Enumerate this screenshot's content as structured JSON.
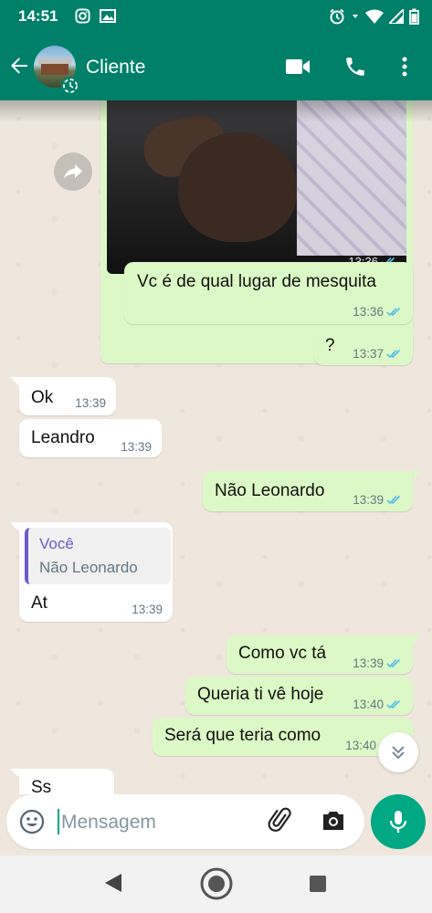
{
  "status_bar": {
    "time": "14:51"
  },
  "header": {
    "contact_name": "Cliente"
  },
  "messages": [
    {
      "dir": "out",
      "type": "image",
      "time": "13:36"
    },
    {
      "dir": "out",
      "text": "Vc é de qual lugar de mesquita",
      "time": "13:36"
    },
    {
      "dir": "out",
      "text": "?",
      "time": "13:37"
    },
    {
      "dir": "in",
      "text": "Ok",
      "time": "13:39"
    },
    {
      "dir": "in",
      "text": "Leandro",
      "time": "13:39"
    },
    {
      "dir": "out",
      "text": "Não Leonardo",
      "time": "13:39"
    },
    {
      "dir": "in",
      "text": "At",
      "time": "13:39",
      "quote": {
        "author": "Você",
        "text": "Não Leonardo"
      }
    },
    {
      "dir": "out",
      "text": "Como vc tá",
      "time": "13:39"
    },
    {
      "dir": "out",
      "text": "Queria ti vê hoje",
      "time": "13:40"
    },
    {
      "dir": "out",
      "text": "Será que teria como",
      "time": "13:40"
    },
    {
      "dir": "in",
      "text": "Ss",
      "time": ""
    }
  ],
  "composer": {
    "placeholder": "Mensagem"
  },
  "colors": {
    "header": "#008069",
    "outgoing_bubble": "#dcf8c6",
    "incoming_bubble": "#ffffff",
    "read_ticks": "#53bdeb",
    "accent": "#00a884"
  }
}
